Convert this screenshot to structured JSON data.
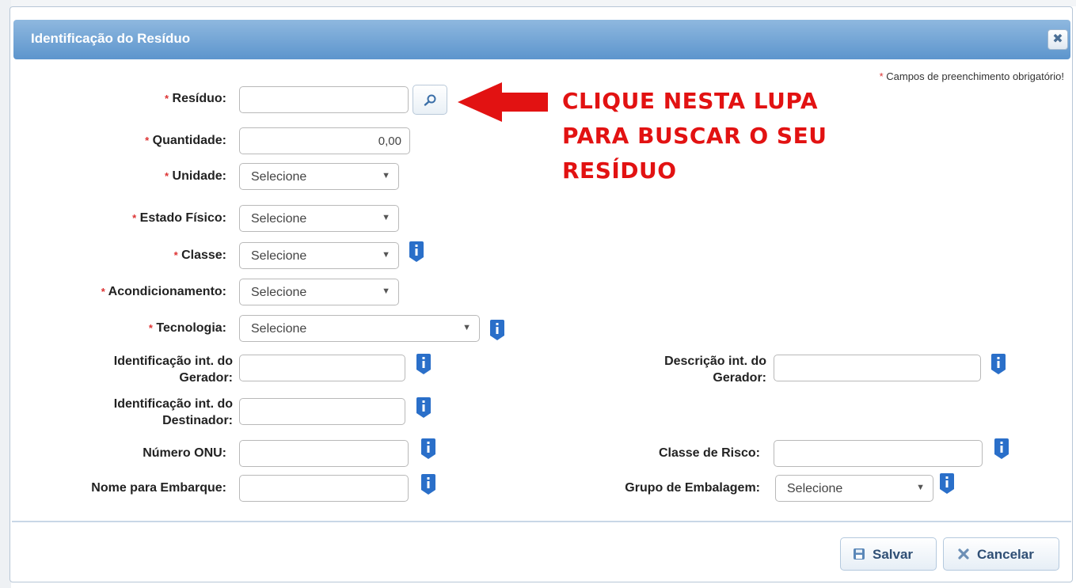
{
  "dialog": {
    "title": "Identificação do Resíduo",
    "close_glyph": "✖",
    "required_marker": "*",
    "required_note": "Campos de preenchimento obrigatório!"
  },
  "fields": {
    "residuo": {
      "label": "Resíduo:",
      "value": ""
    },
    "quantidade": {
      "label": "Quantidade:",
      "value": "0,00"
    },
    "unidade": {
      "label": "Unidade:",
      "selected": "Selecione"
    },
    "estado_fisico": {
      "label": "Estado Físico:",
      "selected": "Selecione"
    },
    "classe": {
      "label": "Classe:",
      "selected": "Selecione"
    },
    "acondicionamento": {
      "label": "Acondicionamento:",
      "selected": "Selecione"
    },
    "tecnologia": {
      "label": "Tecnologia:",
      "selected": "Selecione"
    },
    "ident_gerador": {
      "label_line1": "Identificação int. do",
      "label_line2": "Gerador:",
      "value": ""
    },
    "descr_gerador": {
      "label_line1": "Descrição int. do",
      "label_line2": "Gerador:",
      "value": ""
    },
    "ident_destinador": {
      "label_line1": "Identificação int. do",
      "label_line2": "Destinador:",
      "value": ""
    },
    "numero_onu": {
      "label": "Número ONU:",
      "value": ""
    },
    "classe_risco": {
      "label": "Classe de Risco:",
      "value": ""
    },
    "nome_embarque": {
      "label": "Nome para Embarque:",
      "value": ""
    },
    "grupo_embalagem": {
      "label": "Grupo de Embalagem:",
      "selected": "Selecione"
    }
  },
  "annotation": {
    "line1": "CLIQUE NESTA LUPA",
    "line2": "PARA BUSCAR O SEU",
    "line3": "RESÍDUO",
    "color": "#e21212"
  },
  "buttons": {
    "save_label": "Salvar",
    "cancel_label": "Cancelar"
  },
  "icons": {
    "search": "search-icon",
    "info": "info-icon",
    "save": "floppy-icon",
    "cancel": "x-icon",
    "close": "close-icon",
    "dropdown": "chevron-down-icon"
  },
  "colors": {
    "header_top": "#8fb8df",
    "header_bottom": "#5d95cd",
    "info_icon": "#2a6fc9",
    "button_text": "#2f4f75"
  }
}
